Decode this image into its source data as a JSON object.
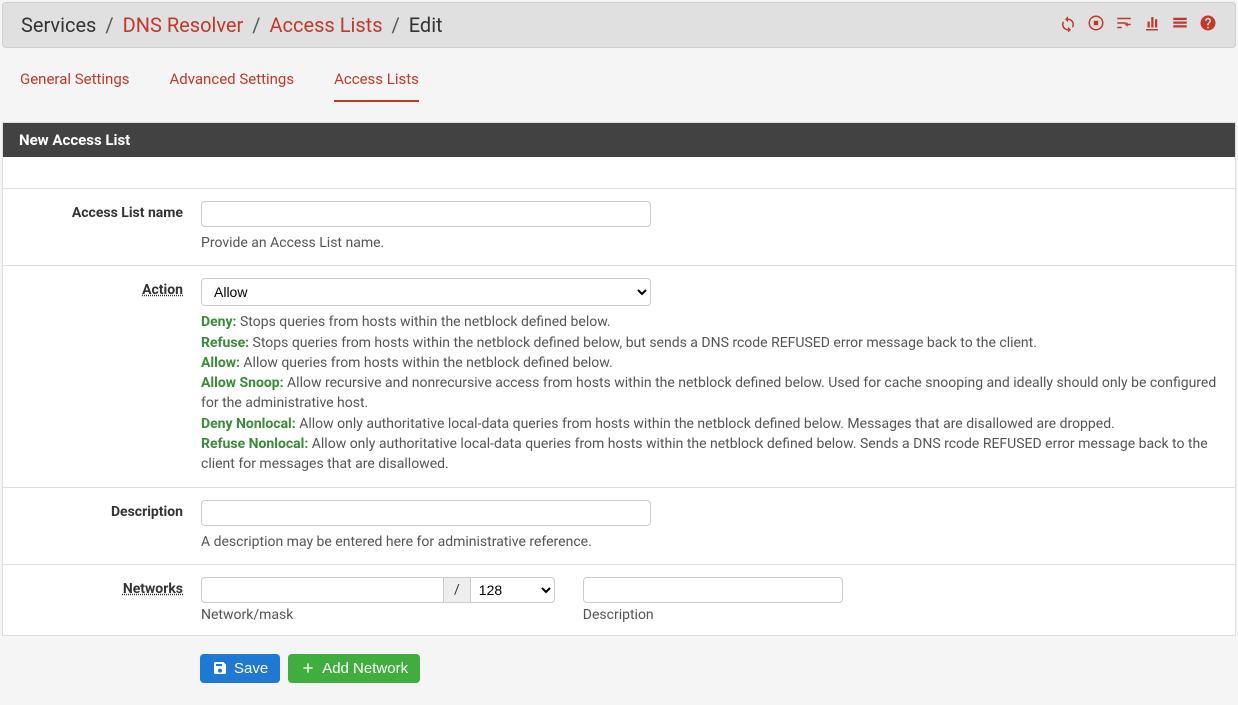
{
  "breadcrumb": {
    "root": "Services",
    "link1": "DNS Resolver",
    "link2": "Access Lists",
    "current": "Edit"
  },
  "tabs": {
    "general": "General Settings",
    "advanced": "Advanced Settings",
    "access": "Access Lists"
  },
  "panel": {
    "title": "New Access List"
  },
  "fields": {
    "name": {
      "label": "Access List name",
      "value": "",
      "help": "Provide an Access List name."
    },
    "action": {
      "label": "Action",
      "selected": "Allow",
      "help": {
        "deny_k": "Deny:",
        "deny_t": " Stops queries from hosts within the netblock defined below.",
        "refuse_k": "Refuse:",
        "refuse_t": " Stops queries from hosts within the netblock defined below, but sends a DNS rcode REFUSED error message back to the client.",
        "allow_k": "Allow:",
        "allow_t": " Allow queries from hosts within the netblock defined below.",
        "snoop_k": "Allow Snoop:",
        "snoop_t": " Allow recursive and nonrecursive access from hosts within the netblock defined below. Used for cache snooping and ideally should only be configured for the administrative host.",
        "dnl_k": "Deny Nonlocal:",
        "dnl_t": " Allow only authoritative local-data queries from hosts within the netblock defined below. Messages that are disallowed are dropped.",
        "rnl_k": "Refuse Nonlocal:",
        "rnl_t": " Allow only authoritative local-data queries from hosts within the netblock defined below. Sends a DNS rcode REFUSED error message back to the client for messages that are disallowed."
      }
    },
    "description": {
      "label": "Description",
      "value": "",
      "help": "A description may be entered here for administrative reference."
    },
    "networks": {
      "label": "Networks",
      "slash": "/",
      "mask_selected": "128",
      "sub_netmask": "Network/mask",
      "sub_desc": "Description",
      "net_value": "",
      "desc_value": ""
    }
  },
  "buttons": {
    "save": "Save",
    "add": "Add Network"
  }
}
